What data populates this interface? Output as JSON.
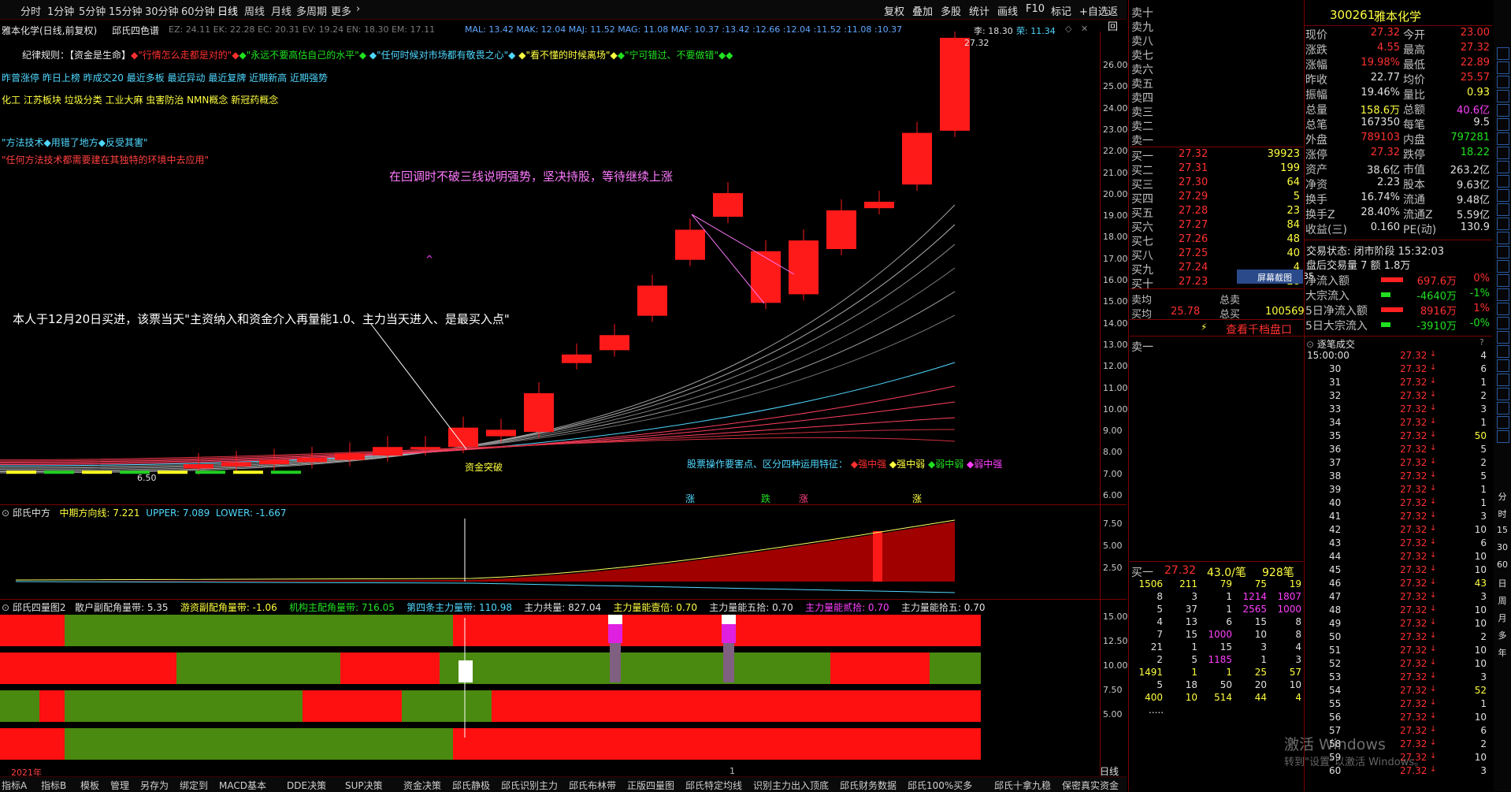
{
  "toolbar": {
    "periods": [
      "分时",
      "1分钟",
      "5分钟",
      "15分钟",
      "30分钟",
      "60分钟",
      "日线",
      "周线",
      "月线",
      "多周期",
      "更多"
    ],
    "actions": [
      "复权",
      "叠加",
      "多股",
      "统计",
      "画线",
      "F10",
      "标记",
      "+自选",
      "返回"
    ]
  },
  "stock": {
    "name_line": "雅本化学(日线,前复权)",
    "indicator": "邱氏四色谱",
    "code": "300261",
    "name": "雅本化学"
  },
  "ma_values_left": "EZ: 24.11  EK: 22.28  EC: 20.31  EV: 19.24  EN: 18.30  EM: 17.11",
  "ma_values_right": "MAL: 13.42  MAK: 12.04  MAJ: 11.52  MAG: 11.08  MAF: 10.37  :13.42  :12.66  :12.04  :11.52  :11.08  :10.37",
  "ma_tail": {
    "li": "李: 18.30",
    "rong": "荣: 11.34"
  },
  "rules": {
    "prefix": "纪律规则：",
    "r1": "【资金是生命】",
    "r2": "\"行情怎么走都是对的\"",
    "r3": "\"永远不要高估自己的水平\"",
    "r4": "\"任何时候对市场都有敬畏之心\"",
    "r5": "\"看不懂的时候离场\"",
    "r6": "\"宁可错过、不要做错\""
  },
  "links_row1": "昨曾涨停 昨日上榜 昨成交20 最近多板 最近异动 最近复牌 近期新高 近期强势",
  "links_row2": "化工 江苏板块 垃圾分类 工业大麻 虫害防治 NMN概念 新冠药概念",
  "method1": "\"方法技术◆用错了地方◆反受其害\"",
  "method2": "\"任何方法技术都需要建在其独特的环境中去应用\"",
  "annot_top": "在回调时不破三线说明强势，坚决持股，等待继续上涨",
  "annot_main": "本人于12月20日买进，该票当天\"主资纳入和资金介入再量能1.0、主力当天进入、是最买入点\"",
  "annot_zijin": "资金突破",
  "features": {
    "label": "股票操作要害点、区分四种运用特征：",
    "a": "◆强中强",
    "b": "◆强中弱",
    "c": "◆弱中弱",
    "d": "◆弱中强"
  },
  "bottom_marks": [
    "涨",
    "跌",
    "涨",
    "涨"
  ],
  "price_high_label": "27.32",
  "price_low_label": "6.50",
  "panel2": {
    "title": "邱氏中方",
    "line": "中期方向线: 7.221",
    "upper": "UPPER: 7.089",
    "lower": "LOWER: -1.667"
  },
  "panel3": {
    "title": "邱氏四量图2",
    "items": [
      "散户副配角量带: 5.35",
      "游资副配角量带: -1.06",
      "机构主配角量带: 716.05",
      "第四条主力量带: 110.98",
      "主力共量: 827.04",
      "主力量能壹倍: 0.70",
      "主力量能五拾: 0.70",
      "主力量能贰拾: 0.70",
      "主力量能拾五: 0.70"
    ]
  },
  "year_label": "2021年",
  "time_axis_mark": "1",
  "period_label": "日线",
  "main_axis": [
    "26.00",
    "25.00",
    "24.00",
    "23.00",
    "22.00",
    "21.00",
    "20.00",
    "19.00",
    "18.00",
    "17.00",
    "16.00",
    "15.00",
    "14.00",
    "13.00",
    "12.00",
    "11.00",
    "10.00",
    "9.00",
    "8.00",
    "7.00",
    "6.00"
  ],
  "p2_axis": [
    "7.50",
    "5.00",
    "2.50"
  ],
  "p3_axis": [
    "15.00",
    "12.50",
    "10.00",
    "7.50",
    "5.00"
  ],
  "order_book": {
    "sells": [
      "卖十",
      "卖九",
      "卖八",
      "卖七",
      "卖六",
      "卖五",
      "卖四",
      "卖三",
      "卖二",
      "卖一"
    ],
    "buys": [
      {
        "l": "买一",
        "p": "27.32",
        "v": "39923"
      },
      {
        "l": "买二",
        "p": "27.31",
        "v": "199"
      },
      {
        "l": "买三",
        "p": "27.30",
        "v": "64"
      },
      {
        "l": "买四",
        "p": "27.29",
        "v": "5"
      },
      {
        "l": "买五",
        "p": "27.28",
        "v": "23"
      },
      {
        "l": "买六",
        "p": "27.27",
        "v": "84"
      },
      {
        "l": "买七",
        "p": "27.26",
        "v": "48"
      },
      {
        "l": "买八",
        "p": "27.25",
        "v": "40"
      },
      {
        "l": "买九",
        "p": "27.24",
        "v": "4"
      },
      {
        "l": "买十",
        "p": "27.23",
        "v": "28"
      }
    ],
    "sell_avg": "卖均",
    "buy_avg": "买均",
    "buy_avg_val": "25.78",
    "total_sell": "总卖",
    "total_buy": "总买",
    "total_buy_val": "100569",
    "view_btn": "查看千档盘口",
    "screenshot_btn": "屏幕截图",
    "screenshot_num": "35",
    "sell1": "卖一"
  },
  "buy1_queue": {
    "label": "买一",
    "price": "27.32",
    "per": "43.0/笔",
    "count": "928笔",
    "rows": [
      [
        "1506",
        "211",
        "79",
        "75",
        "19"
      ],
      [
        "8",
        "3",
        "1",
        "1214",
        "1807"
      ],
      [
        "5",
        "37",
        "1",
        "2565",
        "1000"
      ],
      [
        "4",
        "13",
        "6",
        "15",
        "8"
      ],
      [
        "7",
        "15",
        "1000",
        "10",
        "8"
      ],
      [
        "21",
        "1",
        "15",
        "3",
        "4"
      ],
      [
        "2",
        "5",
        "1185",
        "1",
        "3"
      ],
      [
        "1491",
        "1",
        "1",
        "25",
        "57"
      ],
      [
        "5",
        "18",
        "50",
        "20",
        "10"
      ],
      [
        "400",
        "10",
        "514",
        "44",
        "4"
      ]
    ],
    "more": "....."
  },
  "quote": {
    "rows": [
      [
        "现价",
        "27.32",
        "今开",
        "23.00"
      ],
      [
        "涨跌",
        "4.55",
        "最高",
        "27.32"
      ],
      [
        "涨幅",
        "19.98%",
        "最低",
        "22.89"
      ],
      [
        "昨收",
        "22.77",
        "均价",
        "25.57"
      ],
      [
        "振幅",
        "19.46%",
        "量比",
        "0.93"
      ],
      [
        "总量",
        "158.6万",
        "总额",
        "40.6亿"
      ],
      [
        "总笔",
        "167350",
        "每笔",
        "9.5"
      ],
      [
        "外盘",
        "789103",
        "内盘",
        "797281"
      ],
      [
        "涨停",
        "27.32",
        "跌停",
        "18.22"
      ],
      [
        "资产",
        "38.6亿",
        "市值",
        "263.2亿"
      ],
      [
        "净资",
        "2.23",
        "股本",
        "9.63亿"
      ],
      [
        "换手",
        "16.74%",
        "流通",
        "9.48亿"
      ],
      [
        "换手Z",
        "28.40%",
        "流通Z",
        "5.59亿"
      ],
      [
        "收益(三)",
        "0.160",
        "PE(动)",
        "130.9"
      ]
    ],
    "status": "交易状态: 闭市阶段 15:32:03",
    "after": "盘后交易量 7 额 1.8万",
    "flows": [
      [
        "净流入额",
        "697.6万",
        "0%"
      ],
      [
        "大宗流入",
        "-4640万",
        "-1%"
      ],
      [
        "5日净流入额",
        "8916万",
        "1%"
      ],
      [
        "5日大宗流入",
        "-3910万",
        "-0%"
      ]
    ]
  },
  "ticks": {
    "title": "逐笔成交",
    "first_time": "15:00:00",
    "rows": [
      [
        "15:00:00",
        "4"
      ],
      [
        "30",
        "6"
      ],
      [
        "31",
        "1"
      ],
      [
        "32",
        "2"
      ],
      [
        "33",
        "3"
      ],
      [
        "34",
        "1"
      ],
      [
        "35",
        "50"
      ],
      [
        "36",
        "5"
      ],
      [
        "37",
        "2"
      ],
      [
        "38",
        "5"
      ],
      [
        "39",
        "1"
      ],
      [
        "40",
        "1"
      ],
      [
        "41",
        "3"
      ],
      [
        "42",
        "10"
      ],
      [
        "43",
        "6"
      ],
      [
        "44",
        "10"
      ],
      [
        "45",
        "10"
      ],
      [
        "46",
        "43"
      ],
      [
        "47",
        "3"
      ],
      [
        "48",
        "10"
      ],
      [
        "49",
        "10"
      ],
      [
        "50",
        "2"
      ],
      [
        "51",
        "10"
      ],
      [
        "52",
        "10"
      ],
      [
        "53",
        "3"
      ],
      [
        "54",
        "52"
      ],
      [
        "55",
        "1"
      ],
      [
        "56",
        "10"
      ],
      [
        "57",
        "6"
      ],
      [
        "58",
        "2"
      ],
      [
        "59",
        "10"
      ],
      [
        "60",
        "3"
      ]
    ],
    "price": "27.32"
  },
  "side_icons": [
    "",
    "分",
    "时",
    "15",
    "30",
    "60",
    "日",
    "周",
    "月",
    "多",
    "年"
  ],
  "bottom_tabs": [
    "指标A",
    "指标B",
    "模板",
    "管理",
    "另存为",
    "绑定到",
    "MACD基本",
    "DDE决策",
    "SUP决策",
    "资金决策",
    "邱氏静极",
    "邱氏识别主力",
    "邱氏布林带",
    "正版四量图",
    "邱氏特定均线",
    "识别主力出入顶底",
    "邱氏财务数据",
    "邱氏100%买多",
    "邱氏十拿九稳",
    "保密真实资金"
  ],
  "watermark": {
    "l1": "激活 Windows",
    "l2": "转到\"设置\"以激活 Windows。"
  },
  "chart_data": {
    "type": "candlestick",
    "title": "雅本化学(日线,前复权)",
    "ylim": [
      6,
      27
    ],
    "candles": [
      {
        "o": 7.3,
        "c": 7.5
      },
      {
        "o": 7.4,
        "c": 7.6
      },
      {
        "o": 7.5,
        "c": 7.7
      },
      {
        "o": 7.6,
        "c": 7.8
      },
      {
        "o": 7.7,
        "c": 8.0
      },
      {
        "o": 7.9,
        "c": 8.3
      },
      {
        "o": 8.2,
        "c": 8.3
      },
      {
        "o": 8.3,
        "c": 9.2
      },
      {
        "o": 8.8,
        "c": 9.1
      },
      {
        "o": 9.0,
        "c": 10.8
      },
      {
        "o": 12.2,
        "c": 12.6
      },
      {
        "o": 12.8,
        "c": 13.5
      },
      {
        "o": 14.4,
        "c": 15.8
      },
      {
        "o": 17.0,
        "c": 18.4
      },
      {
        "o": 19.0,
        "c": 20.1
      },
      {
        "o": 17.4,
        "c": 15.0
      },
      {
        "o": 15.4,
        "c": 17.9
      },
      {
        "o": 17.5,
        "c": 19.3
      },
      {
        "o": 19.4,
        "c": 19.7
      },
      {
        "o": 20.5,
        "c": 22.9
      },
      {
        "o": 23.0,
        "c": 27.32
      }
    ]
  }
}
